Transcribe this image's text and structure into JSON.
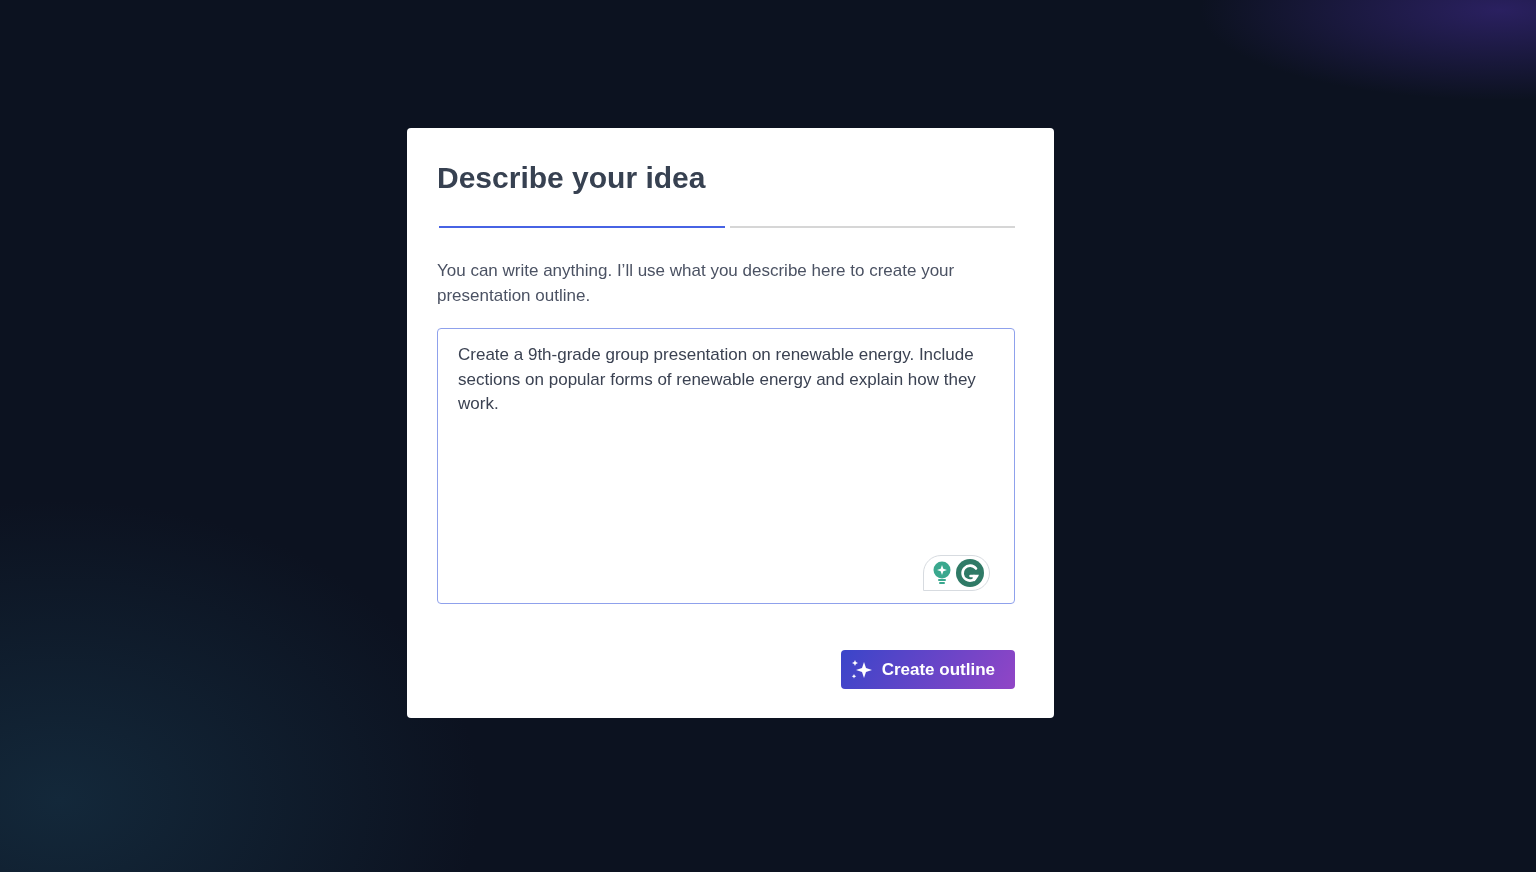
{
  "dialog": {
    "title": "Describe your idea",
    "steps": [
      {
        "selected": true
      },
      {
        "selected": false
      }
    ],
    "description": "You can write anything. I’ll use what you describe here to create your presentation outline.",
    "prompt": {
      "value": "Create a 9th-grade group presentation on renewable energy. Include sections on popular forms of renewable energy and explain how they work."
    },
    "primary_button": {
      "label": "Create outline"
    }
  }
}
